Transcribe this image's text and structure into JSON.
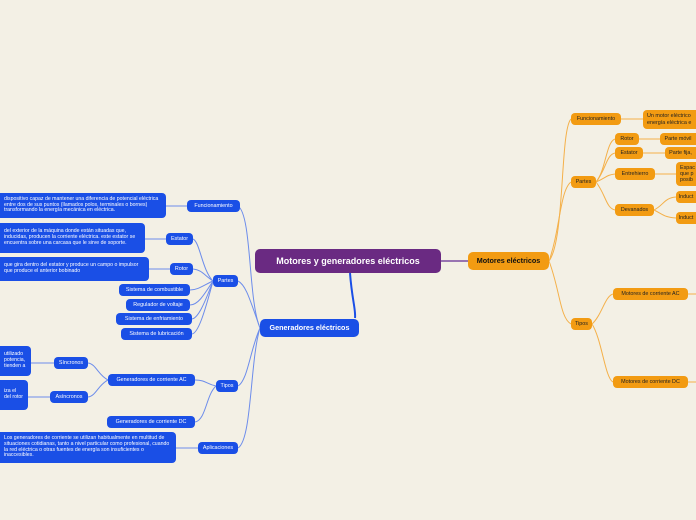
{
  "root": "Motores y generadores eléctricos",
  "generadores": {
    "title": "Generadores eléctricos",
    "funcionamiento": "Funcionamiento",
    "funcionamiento_text": "dispositivo capaz de mantener una diferencia de potencial eléctrica entre dos de sus puntos (llamados polos, terminales o bornes) transformando la energía mecánica en eléctrica.",
    "partes": "Partes",
    "estator": "Estator",
    "estator_text": "del exterior de la máquina donde están situadas que, inducidas, producen la corriente eléctrica. este estator se encuentra sobre una carcasa que le sirve de soporte.",
    "rotor": "Rotor",
    "rotor_text": "que gira dentro del estator y produce un campo o impulsor que produce el anterior bobinado",
    "sistema_combustible": "Sistema de combustible",
    "regulador_voltaje": "Regulador de voltaje",
    "sistema_enfriamiento": "Sistema de enfriamiento",
    "sistema_lubricacion": "Sistema de lubricación",
    "tipos": "Tipos",
    "gen_ac": "Generadores de corriente AC",
    "sincronos": "Síncronos",
    "sincronos_text": "utilizado potencia, tienden a",
    "asincronos": "Asíncronos",
    "asincronos_text": "iza el del rotor",
    "gen_dc": "Generadores de corriente DC",
    "aplicaciones": "Aplicaciones",
    "aplicaciones_text": "Los generadores de corriente se utilizan habitualmente en multitud de situaciones cotidianas, tanto a nivel particular como profesional, cuando la red eléctrica o otras fuentes de energía son insuficientes o inaccesibles."
  },
  "motores": {
    "title": "Motores eléctricos",
    "funcionamiento": "Funcionamiento",
    "funcionamiento_text": "Un motor eléctrico energía eléctrica e",
    "partes": "Partes",
    "rotor": "Rotor",
    "rotor_text": "Parte móvil",
    "estator": "Estator",
    "estator_text": "Parte fija,",
    "entrehierro": "Entrehierro",
    "entrehierro_text": "Espac que p posib",
    "devanados": "Devanados",
    "induct1": "Induct",
    "induct2": "Induct",
    "tipos": "Tipos",
    "motores_ac": "Motores de corriente AC",
    "motores_dc": "Motores de corriente DC"
  },
  "colors": {
    "background": "#f3f0e5",
    "root": "#6a2a82",
    "blue_branch": "#1a4fe6",
    "orange_branch": "#f29b12",
    "blue_line": "#5b7fe8",
    "orange_line": "#f4b049"
  }
}
